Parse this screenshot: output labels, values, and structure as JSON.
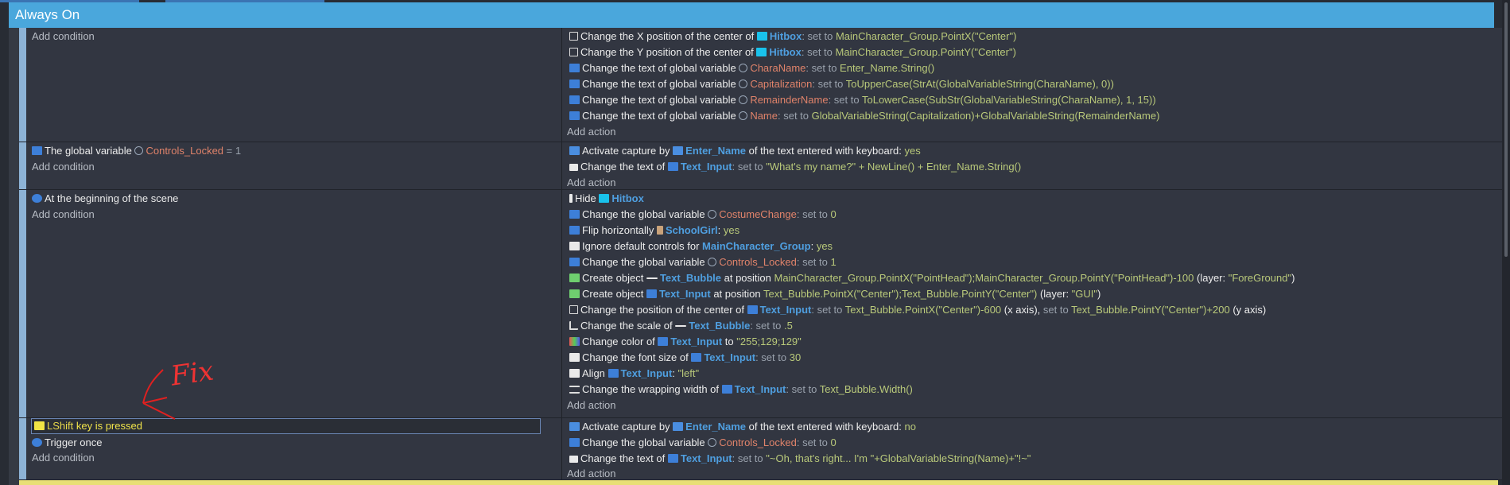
{
  "header": {
    "title": "Always On"
  },
  "labels": {
    "add_condition": "Add condition",
    "add_action": "Add action"
  },
  "event1": {
    "actions": [
      {
        "pre": "Change the X position of the center of ",
        "obj": "Hitbox",
        "mid": ": set to ",
        "val": "MainCharacter_Group.PointX(\"Center\")"
      },
      {
        "pre": "Change the Y position of the center of ",
        "obj": "Hitbox",
        "mid": ": set to ",
        "val": "MainCharacter_Group.PointY(\"Center\")"
      },
      {
        "pre": "Change the text of global variable ",
        "var": "CharaName",
        "mid": ": set to ",
        "val": "Enter_Name.String()"
      },
      {
        "pre": "Change the text of global variable ",
        "var": "Capitalization",
        "mid": ": set to ",
        "val": "ToUpperCase(StrAt(GlobalVariableString(CharaName), 0))"
      },
      {
        "pre": "Change the text of global variable ",
        "var": "RemainderName",
        "mid": ": set to ",
        "val": "ToLowerCase(SubStr(GlobalVariableString(CharaName), 1, 15))"
      },
      {
        "pre": "Change the text of global variable ",
        "var": "Name",
        "mid": ": set to ",
        "val": "GlobalVariableString(Capitalization)+GlobalVariableString(RemainderName)"
      }
    ]
  },
  "event2": {
    "cond": {
      "pre": "The global variable ",
      "var": "Controls_Locked",
      "post": " = 1"
    },
    "actions": [
      {
        "pre": "Activate capture by ",
        "obj": "Enter_Name",
        "mid": " of the text entered with keyboard: ",
        "val": "yes"
      },
      {
        "pre": "Change the text of ",
        "obj": "Text_Input",
        "mid": ": set to ",
        "val": "\"What's my name?\" + NewLine() + Enter_Name.String()"
      }
    ]
  },
  "event3": {
    "cond": {
      "text": "At the beginning of the scene"
    },
    "actions": [
      {
        "pre": "Hide ",
        "obj": "Hitbox"
      },
      {
        "pre": "Change the global variable ",
        "var": "CostumeChange",
        "mid": ": set to ",
        "val": "0"
      },
      {
        "pre": "Flip horizontally ",
        "obj": "SchoolGirl",
        "mid": ": ",
        "val": "yes"
      },
      {
        "pre": "Ignore default controls for ",
        "obj": "MainCharacter_Group",
        "mid": ": ",
        "val": "yes"
      },
      {
        "pre": "Change the global variable ",
        "var": "Controls_Locked",
        "mid": ": set to ",
        "val": "1"
      },
      {
        "pre": "Create object ",
        "obj": "Text_Bubble",
        "mid": " at position ",
        "val": "MainCharacter_Group.PointX(\"PointHead\");MainCharacter_Group.PointY(\"PointHead\")-100",
        "post": " (layer: ",
        "val2": "\"ForeGround\"",
        "post2": ")"
      },
      {
        "pre": "Create object ",
        "obj": "Text_Input",
        "mid": " at position ",
        "val": "Text_Bubble.PointX(\"Center\");Text_Bubble.PointY(\"Center\")",
        "post": " (layer: ",
        "val2": "\"GUI\"",
        "post2": ")"
      },
      {
        "pre": "Change the position of the center of ",
        "obj": "Text_Input",
        "mid": ": set to ",
        "val": "Text_Bubble.PointX(\"Center\")-600",
        "post": " (x axis), ",
        "dim2": "set to ",
        "val2": "Text_Bubble.PointY(\"Center\")+200",
        "post2": " (y axis)"
      },
      {
        "pre": "Change the scale of ",
        "obj": "Text_Bubble",
        "mid": ": set to ",
        "val": ".5"
      },
      {
        "pre": "Change color of ",
        "obj": "Text_Input",
        "mid": " to ",
        "val": "\"255;129;129\""
      },
      {
        "pre": "Change the font size of ",
        "obj": "Text_Input",
        "mid": ": set to ",
        "val": "30"
      },
      {
        "pre": "Align ",
        "obj": "Text_Input",
        "mid": ": ",
        "val": "\"left\""
      },
      {
        "pre": "Change the wrapping width of ",
        "obj": "Text_Input",
        "mid": ": set to ",
        "val": "Text_Bubble.Width()"
      }
    ]
  },
  "event4": {
    "cond1": {
      "key": "LShift",
      "post": " key is pressed"
    },
    "cond2": {
      "text": "Trigger once"
    },
    "actions": [
      {
        "pre": "Activate capture by ",
        "obj": "Enter_Name",
        "mid": " of the text entered with keyboard: ",
        "val": "no"
      },
      {
        "pre": "Change the global variable ",
        "var": "Controls_Locked",
        "mid": ": set to ",
        "val": "0"
      },
      {
        "pre": "Change the text of ",
        "obj": "Text_Input",
        "mid": ": set to ",
        "val": "\"~Oh, that's right... I'm \"+GlobalVariableString(Name)+\"!~\""
      }
    ]
  },
  "annotation": {
    "text": "Fix",
    "color": "#e02020"
  },
  "colors": {
    "header": "#4aa7dc",
    "background": "#282c34",
    "object": "#4f9fe0",
    "variable": "#e0836a",
    "value": "#b9c97a"
  }
}
